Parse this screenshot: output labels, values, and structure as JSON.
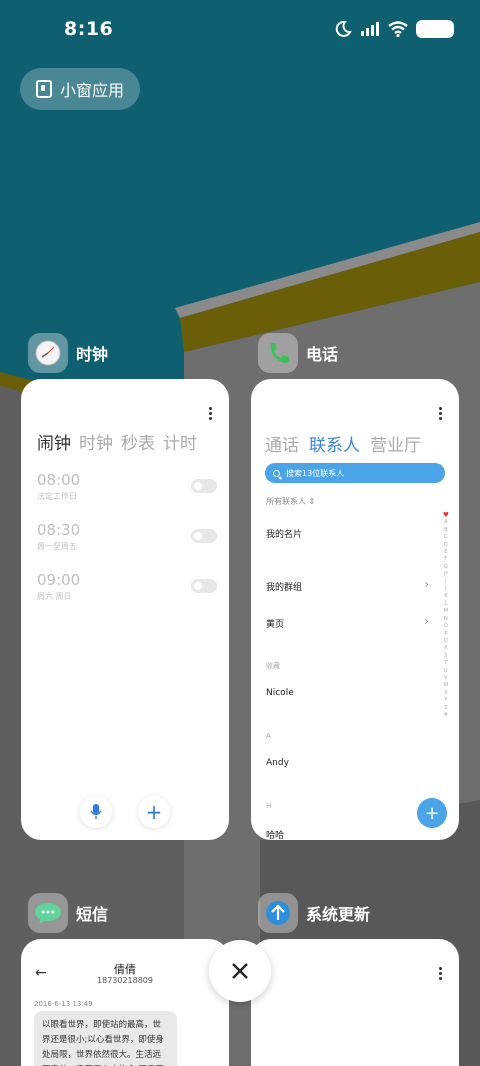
{
  "status_bar": {
    "time": "8:16"
  },
  "small_window": {
    "label": "小窗应用"
  },
  "apps": {
    "clock": {
      "name": "时钟",
      "tabs": [
        "闹钟",
        "时钟",
        "秒表",
        "计时"
      ],
      "alarms": [
        {
          "time": "08:00",
          "repeat": "法定工作日"
        },
        {
          "time": "08:30",
          "repeat": "周一至周五"
        },
        {
          "time": "09:00",
          "repeat": "周六 周日"
        }
      ]
    },
    "phone": {
      "name": "电话",
      "tabs": [
        "通话",
        "联系人",
        "营业厅"
      ],
      "search_placeholder": "搜索13位联系人",
      "all_contacts": "所有联系人",
      "my_card": "我的名片",
      "my_groups": "我的群组",
      "yellow_pages": "黄页",
      "section_favorites": "收藏",
      "contact_1": "Nicole",
      "section_a": "A",
      "contact_2": "Andy",
      "section_h": "H",
      "contact_3": "哈哈",
      "index_letters": [
        "A",
        "B",
        "C",
        "D",
        "E",
        "F",
        "G",
        "H",
        "I",
        "J",
        "K",
        "L",
        "M",
        "N",
        "O",
        "P",
        "Q",
        "R",
        "S",
        "T",
        "U",
        "V",
        "W",
        "X",
        "Y",
        "Z",
        "#"
      ]
    },
    "sms": {
      "name": "短信",
      "contact_name": "倩倩",
      "contact_number": "18730218809",
      "date": "2016-6-13 13:49",
      "message": "以眼看世界，即使站的最高，世界还是很小;以心看世界，即使身处局限，世界依然很大。生活远不完美，需要用心去体会;不需要在人"
    },
    "update": {
      "name": "系统更新"
    }
  },
  "colors": {
    "sky": "#0e5f70",
    "accent_blue": "#4ba3e8",
    "mustard": "#6b5e08"
  }
}
